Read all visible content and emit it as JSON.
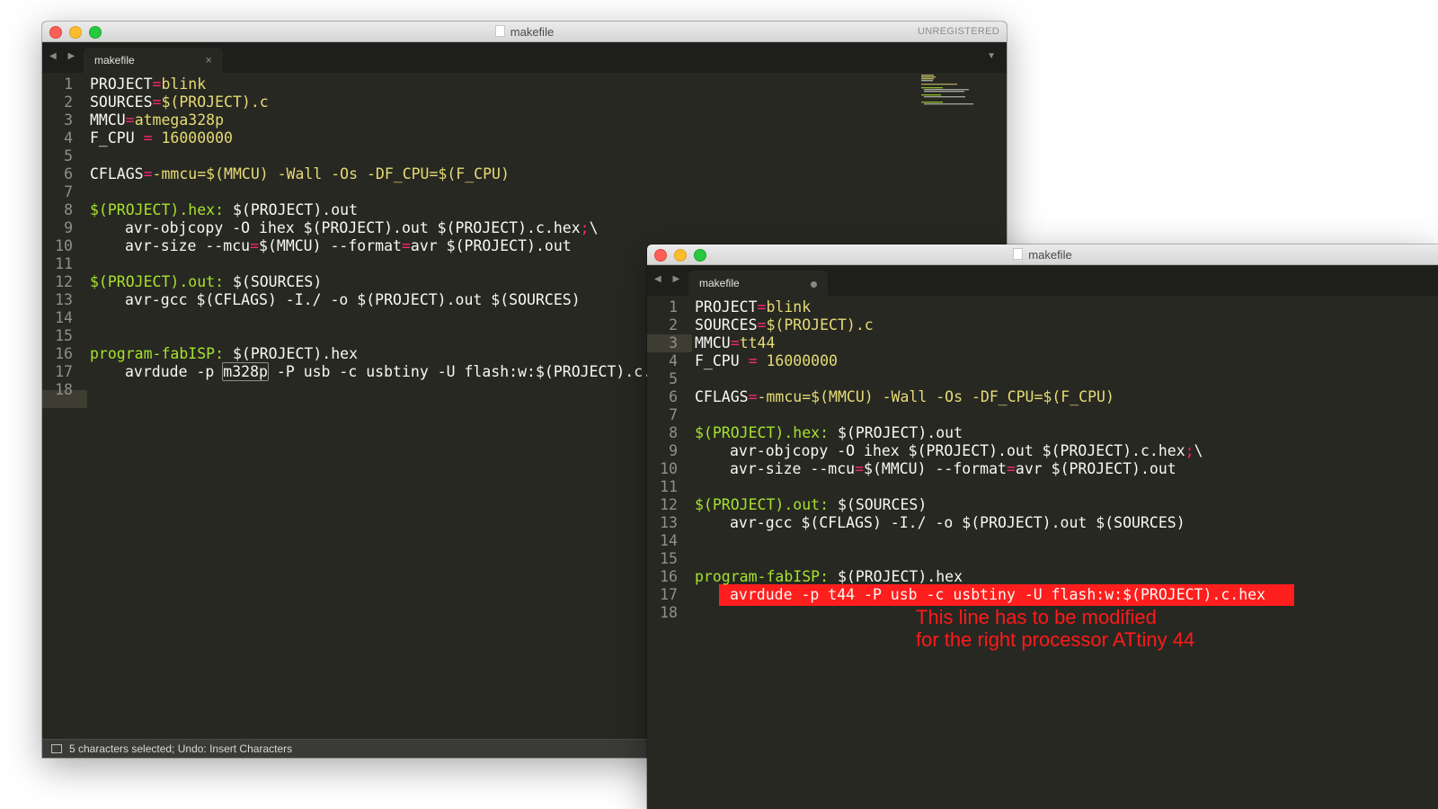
{
  "window1": {
    "title": "makefile",
    "badge": "UNREGISTERED",
    "tab_label": "makefile",
    "tab_close": "×",
    "nav_arrows": "◀ ▶",
    "dropdown": "▼",
    "lines": {
      "l1": {
        "n": "1",
        "a": "PROJECT",
        "b": "=",
        "c": "blink"
      },
      "l2": {
        "n": "2",
        "a": "SOURCES",
        "b": "=",
        "c": "$(PROJECT).c"
      },
      "l3": {
        "n": "3",
        "a": "MMCU",
        "b": "=",
        "c": "atmega328p"
      },
      "l4": {
        "n": "4",
        "a": "F_CPU",
        "b": " = ",
        "c": "16000000"
      },
      "l5": {
        "n": "5"
      },
      "l6": {
        "n": "6",
        "a": "CFLAGS",
        "b": "=",
        "c": "-mmcu=$(MMCU) -Wall -Os -DF_CPU=$(F_CPU)"
      },
      "l7": {
        "n": "7"
      },
      "l8": {
        "n": "8",
        "a": "$(PROJECT).hex:",
        "b": " $(PROJECT).out"
      },
      "l9": {
        "n": "9",
        "a": "avr-objcopy -O ihex $(PROJECT).out $(PROJECT).c.hex",
        "b": ";",
        "c": "\\"
      },
      "l10": {
        "n": "10",
        "a": "avr-size --mcu",
        "b": "=",
        "c": "$(MMCU) --format",
        "d": "=",
        "e": "avr $(PROJECT).out"
      },
      "l11": {
        "n": "11"
      },
      "l12": {
        "n": "12",
        "a": "$(PROJECT).out:",
        "b": " $(SOURCES)"
      },
      "l13": {
        "n": "13",
        "a": "avr-gcc $(CFLAGS) -I./ -o $(PROJECT).out $(SOURCES)"
      },
      "l14": {
        "n": "14"
      },
      "l15": {
        "n": "15"
      },
      "l16": {
        "n": "16",
        "a": "program-fabISP:",
        "b": " $(PROJECT).hex"
      },
      "l17": {
        "n": "17",
        "a": "avrdude -p ",
        "b": "m328p",
        "c": " -P usb -c usbtiny -U flash:w:$(PROJECT).c.hex"
      },
      "l18": {
        "n": "18"
      }
    },
    "status": "5 characters selected; Undo: Insert Characters"
  },
  "window2": {
    "title": "makefile",
    "tab_label": "makefile",
    "nav_arrows": "◀ ▶",
    "lines": {
      "l1": {
        "n": "1",
        "a": "PROJECT",
        "b": "=",
        "c": "blink"
      },
      "l2": {
        "n": "2",
        "a": "SOURCES",
        "b": "=",
        "c": "$(PROJECT).c"
      },
      "l3": {
        "n": "3",
        "a": "MMCU",
        "b": "=",
        "c": "tt44"
      },
      "l4": {
        "n": "4",
        "a": "F_CPU",
        "b": " = ",
        "c": "16000000"
      },
      "l5": {
        "n": "5"
      },
      "l6": {
        "n": "6",
        "a": "CFLAGS",
        "b": "=",
        "c": "-mmcu=$(MMCU) -Wall -Os -DF_CPU=$(F_CPU)"
      },
      "l7": {
        "n": "7"
      },
      "l8": {
        "n": "8",
        "a": "$(PROJECT).hex:",
        "b": " $(PROJECT).out"
      },
      "l9": {
        "n": "9",
        "a": "avr-objcopy -O ihex $(PROJECT).out $(PROJECT).c.hex",
        "b": ";",
        "c": "\\"
      },
      "l10": {
        "n": "10",
        "a": "avr-size --mcu",
        "b": "=",
        "c": "$(MMCU) --format",
        "d": "=",
        "e": "avr $(PROJECT).out"
      },
      "l11": {
        "n": "11"
      },
      "l12": {
        "n": "12",
        "a": "$(PROJECT).out:",
        "b": " $(SOURCES)"
      },
      "l13": {
        "n": "13",
        "a": "avr-gcc $(CFLAGS) -I./ -o $(PROJECT).out $(SOURCES)"
      },
      "l14": {
        "n": "14"
      },
      "l15": {
        "n": "15"
      },
      "l16": {
        "n": "16",
        "a": "program-fabISP:",
        "b": " $(PROJECT).hex"
      },
      "l17": {
        "n": "17",
        "a": "avrdude -p t44 -P usb -c usbtiny -U flash:w:$(PROJECT).c.hex"
      },
      "l18": {
        "n": "18"
      }
    },
    "annotation_line1": "This line has to be modified",
    "annotation_line2": "for the right processor ATtiny 44"
  },
  "colors": {
    "editor_bg": "#272822",
    "keyword_green": "#a6e22e",
    "string_yellow": "#e6db74",
    "operator_pink": "#f92672",
    "highlight_red": "#ff1e1e"
  }
}
